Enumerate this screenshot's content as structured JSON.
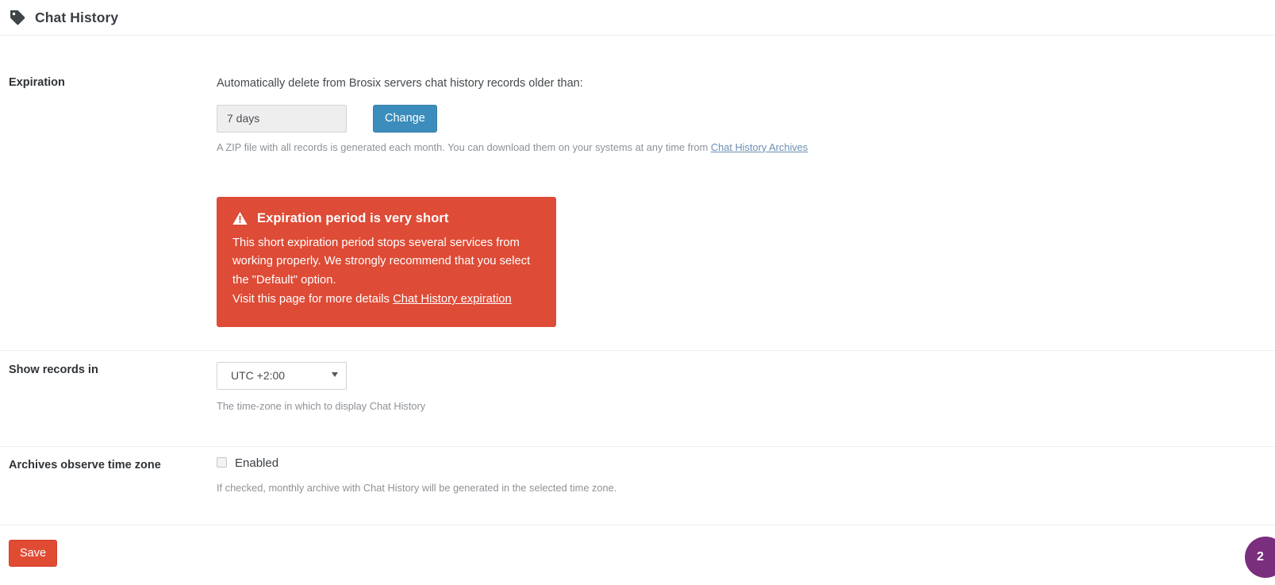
{
  "header": {
    "icon": "tag-icon",
    "title": "Chat History"
  },
  "sections": {
    "expiration": {
      "label": "Expiration",
      "intro": "Automatically delete from Brosix servers chat history records older than:",
      "value_field": "7 days",
      "change_button": "Change",
      "hint_text": "A ZIP file with all records is generated each month. You can download them on your systems at any time from ",
      "hint_link": "Chat History Archives",
      "alert": {
        "icon": "warning-triangle-icon",
        "title": "Expiration period is very short",
        "body_line1": "This short expiration period stops several services from working properly. We strongly recommend that you select the \"Default\" option.",
        "body_line2": "Visit this page for more details ",
        "body_link": "Chat History expiration",
        "color": "#de4b36"
      }
    },
    "timezone": {
      "label": "Show records in",
      "selected": "UTC +2:00",
      "caret": "chevron-down-icon",
      "hint": "The time-zone in which to display Chat History"
    },
    "archives": {
      "label": "Archives observe time zone",
      "checkbox_label": "Enabled",
      "checked": false,
      "hint": "If checked, monthly archive with Chat History will be generated in the selected time zone."
    }
  },
  "footer": {
    "save_label": "Save",
    "save_color": "#e04b34"
  },
  "badge": {
    "count": "2",
    "color": "#7b2d7e"
  }
}
